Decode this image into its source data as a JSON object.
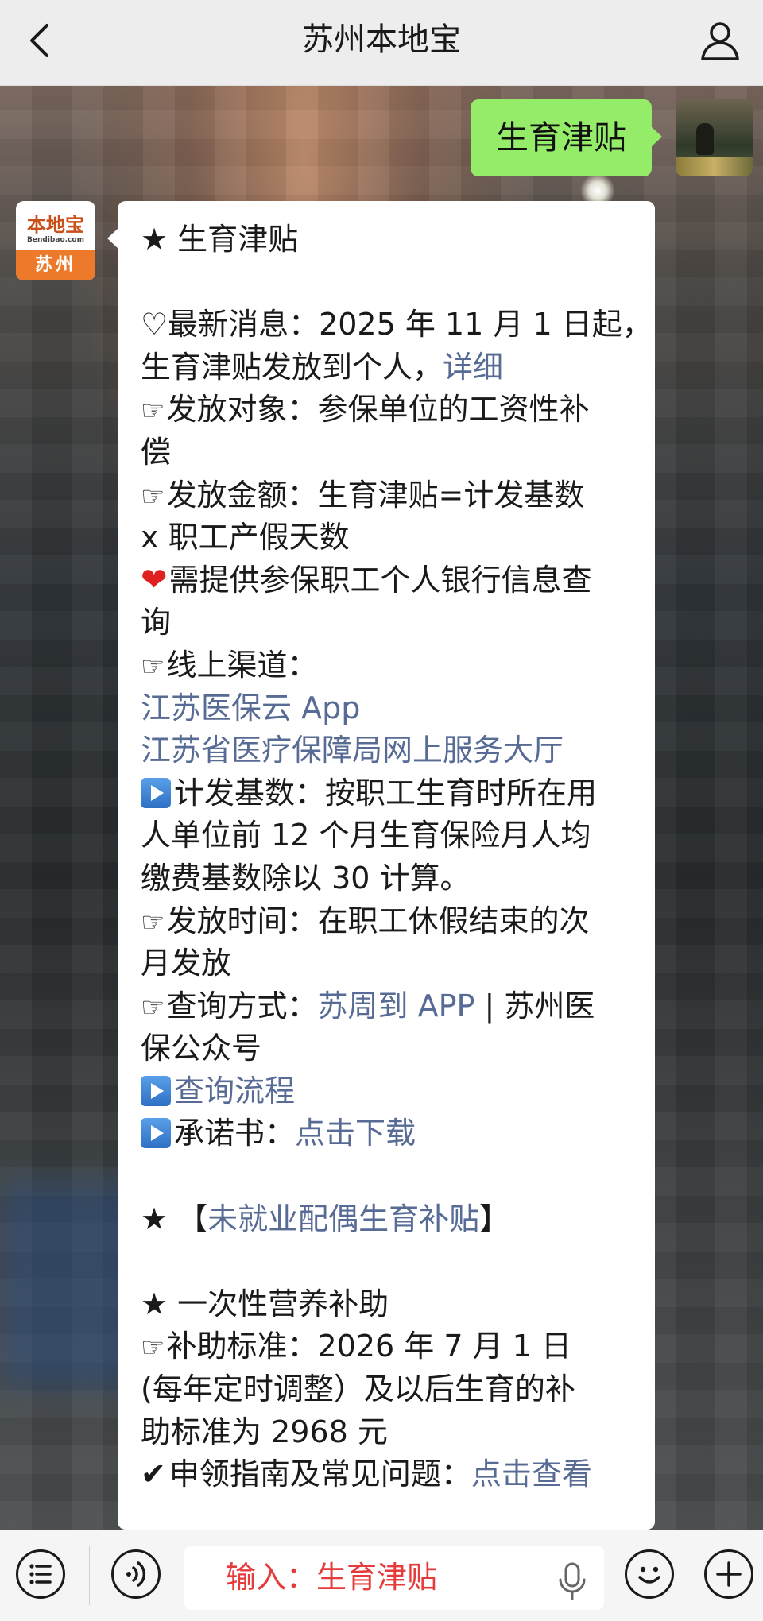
{
  "header": {
    "title": "苏州本地宝"
  },
  "avatar_logo": {
    "brand": "本地宝",
    "domain": "Bendibao.com",
    "city": "苏州"
  },
  "outgoing_message": {
    "text": "生育津贴"
  },
  "message": {
    "l01": "★ 生育津贴",
    "l03": "♡最新消息：2025 年 11 月 1 日起，",
    "l04a": "生育津贴发放到个人，",
    "l04link": "详细",
    "l05": "发放对象：参保单位的工资性补",
    "l06": "偿",
    "l07": "发放金额：生育津贴=计发基数",
    "l08": "x 职工产假天数",
    "l09": "需提供参保职工个人银行信息查",
    "l10": "询",
    "l11": "线上渠道：",
    "l12link": "江苏医保云 App",
    "l13link": "江苏省医疗保障局网上服务大厅",
    "l14": "计发基数：按职工生育时所在用",
    "l15": "人单位前 12 个月生育保险月人均",
    "l16": "缴费基数除以 30 计算。",
    "l17": "发放时间：在职工休假结束的次",
    "l18": "月发放",
    "l19a": "查询方式：",
    "l19link": "苏周到 APP",
    "l19b": " | 苏州医",
    "l20": "保公众号",
    "l21link": "查询流程",
    "l22a": "承诺书：",
    "l22link": "点击下载",
    "l24a": "★ 【",
    "l24link": "未就业配偶生育补贴",
    "l24b": "】",
    "l26": "★ 一次性营养补助",
    "l27": "补助标准：2026 年 7 月 1 日",
    "l28": "(每年定时调整）及以后生育的补",
    "l29": "助标准为 2968 元",
    "l30a": "申领指南及常见问题：",
    "l30link": "点击查看"
  },
  "input": {
    "text": "输入：生育津贴"
  },
  "colors": {
    "link": "#576b95",
    "bubble_out": "#95ec69",
    "input_text": "#e63b3b"
  },
  "icons": [
    "back-icon",
    "user-icon",
    "menu-icon",
    "voice-icon",
    "mic-icon",
    "emoji-icon",
    "plus-icon",
    "pointing-hand-icon",
    "red-heart-icon",
    "play-button-icon",
    "check-mark-icon"
  ]
}
